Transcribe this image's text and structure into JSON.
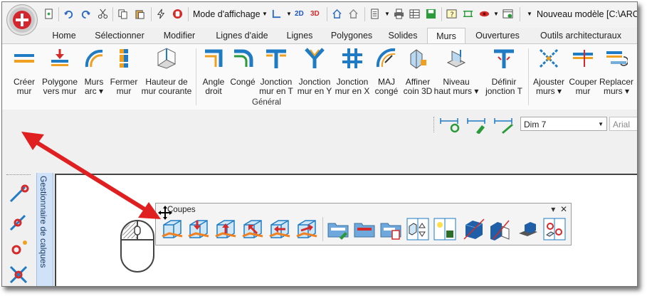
{
  "qat": {
    "view_mode_label": "Mode d'affichage",
    "badge_2d": "2D",
    "badge_3d": "3D",
    "window_title": "Nouveau modèle [C:\\ARC-"
  },
  "tabs": [
    {
      "label": "Home"
    },
    {
      "label": "Sélectionner"
    },
    {
      "label": "Modifier"
    },
    {
      "label": "Lignes d'aide"
    },
    {
      "label": "Lignes"
    },
    {
      "label": "Polygones"
    },
    {
      "label": "Solides"
    },
    {
      "label": "Murs"
    },
    {
      "label": "Ouvertures"
    },
    {
      "label": "Outils architecturaux"
    }
  ],
  "active_tab": "Murs",
  "ribbon": {
    "group_label": "Général",
    "buttons": [
      {
        "line1": "Créer",
        "line2": "mur"
      },
      {
        "line1": "Polygone",
        "line2": "vers mur"
      },
      {
        "line1": "Murs",
        "line2": "arc ▾"
      },
      {
        "line1": "Fermer",
        "line2": "mur"
      },
      {
        "line1": "Hauteur de",
        "line2": "mur courante"
      },
      {
        "line1": "Angle",
        "line2": "droit"
      },
      {
        "line1": "Congé",
        "line2": ""
      },
      {
        "line1": "Jonction",
        "line2": "mur en T"
      },
      {
        "line1": "Jonction",
        "line2": "mur en Y"
      },
      {
        "line1": "Jonction",
        "line2": "mur en X"
      },
      {
        "line1": "MAJ",
        "line2": "congé"
      },
      {
        "line1": "Affiner",
        "line2": "coin 3D"
      },
      {
        "line1": "Niveau",
        "line2": "haut murs ▾"
      },
      {
        "line1": "Définir",
        "line2": "jonction T"
      },
      {
        "line1": "Ajouster",
        "line2": "murs ▾"
      },
      {
        "line1": "Couper",
        "line2": "mur"
      },
      {
        "line1": "Replacer",
        "line2": "murs ▾"
      }
    ]
  },
  "dim_style": {
    "value": "Dim 7"
  },
  "font_combo": {
    "value": "Arial"
  },
  "layer_manager": {
    "label": "Gestionnaire de calques"
  },
  "coupes_toolbar": {
    "title": "Coupes",
    "menu_glyph": "▾",
    "close_glyph": "✕"
  },
  "colors": {
    "accent_red": "#e02020",
    "ribbon_blue": "#1e7bc4",
    "ribbon_orange": "#f0a020",
    "ribbon_green": "#3aa03a"
  }
}
